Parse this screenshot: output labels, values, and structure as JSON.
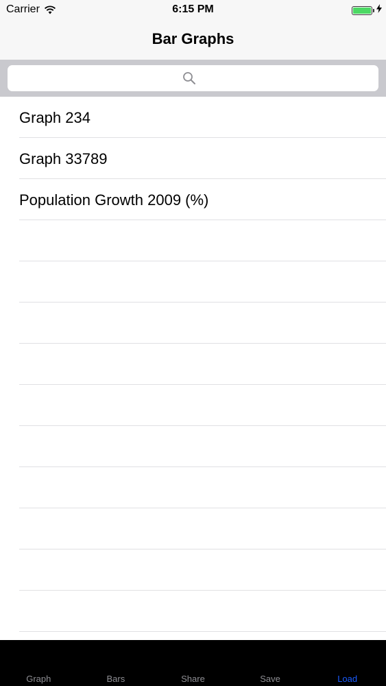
{
  "status_bar": {
    "carrier": "Carrier",
    "time": "6:15 PM",
    "battery_level": 1.0,
    "icons": [
      "wifi-icon",
      "battery-icon",
      "charging-bolt-icon"
    ]
  },
  "nav": {
    "title": "Bar Graphs"
  },
  "search": {
    "placeholder": "",
    "value": "",
    "icon": "search-icon"
  },
  "list": {
    "items": [
      {
        "label": "Graph 234"
      },
      {
        "label": "Graph 33789"
      },
      {
        "label": "Population Growth 2009 (%)"
      },
      {
        "label": ""
      },
      {
        "label": ""
      },
      {
        "label": ""
      },
      {
        "label": ""
      },
      {
        "label": ""
      },
      {
        "label": ""
      },
      {
        "label": ""
      },
      {
        "label": ""
      },
      {
        "label": ""
      },
      {
        "label": ""
      }
    ]
  },
  "tabs": {
    "items": [
      {
        "label": "Graph",
        "active": false
      },
      {
        "label": "Bars",
        "active": false
      },
      {
        "label": "Share",
        "active": false
      },
      {
        "label": "Save",
        "active": false
      },
      {
        "label": "Load",
        "active": true
      }
    ]
  },
  "colors": {
    "accent": "#1a5cff",
    "battery": "#4cd964",
    "tab_bar_bg": "#000000",
    "tab_inactive": "#8e8e93",
    "search_bar_bg": "#c9c9ce",
    "nav_bg": "#f7f7f7"
  }
}
